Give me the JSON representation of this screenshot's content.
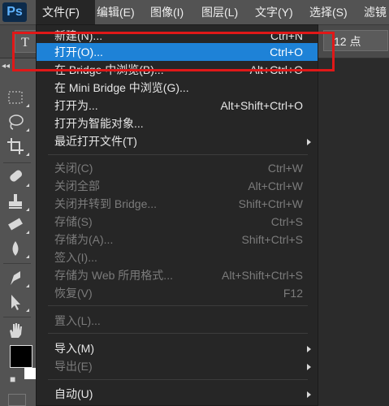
{
  "app": {
    "logo": "Ps"
  },
  "menubar": {
    "items": [
      {
        "label": "文件(F)",
        "active": true
      },
      {
        "label": "编辑(E)"
      },
      {
        "label": "图像(I)"
      },
      {
        "label": "图层(L)"
      },
      {
        "label": "文字(Y)"
      },
      {
        "label": "选择(S)"
      },
      {
        "label": "滤镜"
      }
    ]
  },
  "options": {
    "font_size": "12 点"
  },
  "tools": {
    "icons": [
      "marquee-icon",
      "lasso-icon",
      "crop-icon",
      "healing-icon",
      "stamp-icon",
      "eraser-icon",
      "blur-icon",
      "pen-icon",
      "path-select-icon",
      "hand-icon"
    ]
  },
  "file_menu": {
    "items": [
      {
        "label": "新建(N)...",
        "shortcut": "Ctrl+N"
      },
      {
        "label": "打开(O)...",
        "shortcut": "Ctrl+O",
        "highlighted": true
      },
      {
        "label": "在 Bridge 中浏览(B)...",
        "shortcut": "Alt+Ctrl+O"
      },
      {
        "label": "在 Mini Bridge 中浏览(G)...",
        "shortcut": ""
      },
      {
        "label": "打开为...",
        "shortcut": "Alt+Shift+Ctrl+O"
      },
      {
        "label": "打开为智能对象...",
        "shortcut": ""
      },
      {
        "label": "最近打开文件(T)",
        "shortcut": "",
        "submenu": true
      },
      {
        "label": "关闭(C)",
        "shortcut": "Ctrl+W",
        "disabled": true
      },
      {
        "label": "关闭全部",
        "shortcut": "Alt+Ctrl+W",
        "disabled": true
      },
      {
        "label": "关闭并转到 Bridge...",
        "shortcut": "Shift+Ctrl+W",
        "disabled": true
      },
      {
        "label": "存储(S)",
        "shortcut": "Ctrl+S",
        "disabled": true
      },
      {
        "label": "存储为(A)...",
        "shortcut": "Shift+Ctrl+S",
        "disabled": true
      },
      {
        "label": "签入(I)...",
        "shortcut": "",
        "disabled": true
      },
      {
        "label": "存储为 Web 所用格式...",
        "shortcut": "Alt+Shift+Ctrl+S",
        "disabled": true
      },
      {
        "label": "恢复(V)",
        "shortcut": "F12",
        "disabled": true
      },
      {
        "label": "置入(L)...",
        "shortcut": "",
        "disabled": true
      },
      {
        "label": "导入(M)",
        "shortcut": "",
        "submenu": true
      },
      {
        "label": "导出(E)",
        "shortcut": "",
        "submenu": true,
        "disabled": true
      },
      {
        "label": "自动(U)",
        "shortcut": "",
        "submenu": true
      }
    ]
  },
  "colors": {
    "highlight": "#1e82d7",
    "annotation_box": "#e01818"
  }
}
